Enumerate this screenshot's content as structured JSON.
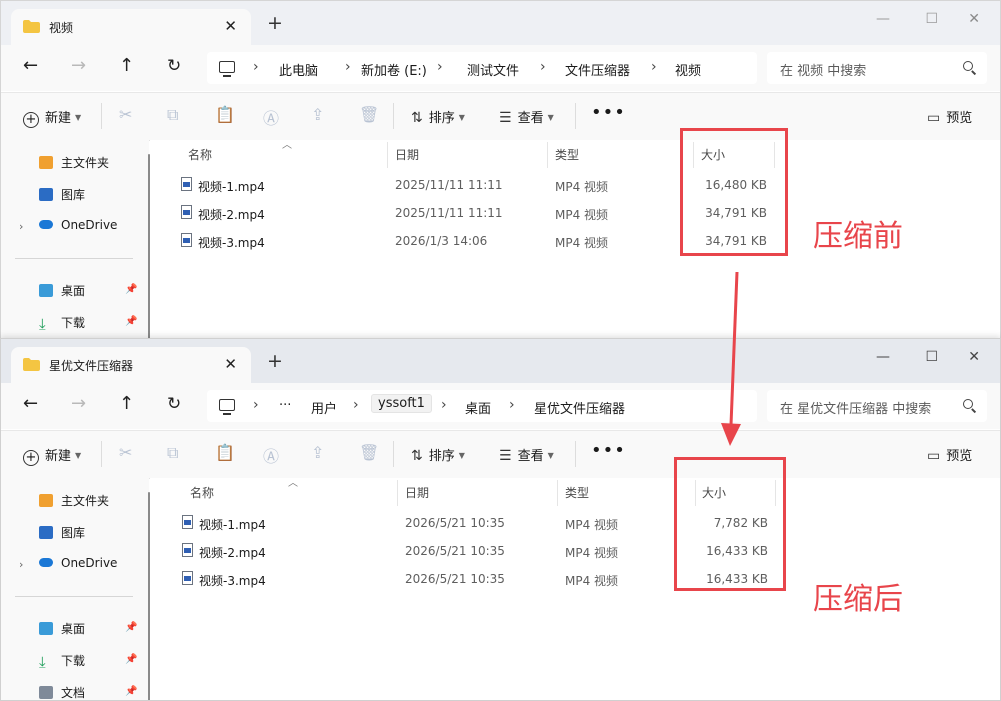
{
  "top_window": {
    "tab_title": "视频",
    "breadcrumbs": [
      "此电脑",
      "新加卷 (E:)",
      "测试文件",
      "文件压缩器",
      "视频"
    ],
    "search_placeholder": "在 视频 中搜索",
    "toolbar": {
      "new_label": "新建",
      "sort_label": "排序",
      "view_label": "查看",
      "more_label": "•••",
      "preview_label": "预览"
    },
    "sidebar": {
      "home": "主文件夹",
      "gallery": "图库",
      "onedrive": "OneDrive",
      "desktop": "桌面",
      "downloads": "下载"
    },
    "columns": {
      "name": "名称",
      "date": "日期",
      "type": "类型",
      "size": "大小"
    },
    "files": [
      {
        "name": "视频-1.mp4",
        "date": "2025/11/11 11:11",
        "type": "MP4 视频",
        "size": "16,480 KB"
      },
      {
        "name": "视频-2.mp4",
        "date": "2025/11/11 11:11",
        "type": "MP4 视频",
        "size": "34,791 KB"
      },
      {
        "name": "视频-3.mp4",
        "date": "2026/1/3 14:06",
        "type": "MP4 视频",
        "size": "34,791 KB"
      }
    ]
  },
  "bottom_window": {
    "tab_title": "星优文件压缩器",
    "breadcrumbs": [
      "···",
      "用户",
      "yssoft1",
      "桌面",
      "星优文件压缩器"
    ],
    "search_placeholder": "在 星优文件压缩器 中搜索",
    "toolbar": {
      "new_label": "新建",
      "sort_label": "排序",
      "view_label": "查看",
      "more_label": "•••",
      "preview_label": "预览"
    },
    "sidebar": {
      "home": "主文件夹",
      "gallery": "图库",
      "onedrive": "OneDrive",
      "desktop": "桌面",
      "downloads": "下载",
      "documents": "文档"
    },
    "columns": {
      "name": "名称",
      "date": "日期",
      "type": "类型",
      "size": "大小"
    },
    "files": [
      {
        "name": "视频-1.mp4",
        "date": "2026/5/21 10:35",
        "type": "MP4 视频",
        "size": "7,782 KB"
      },
      {
        "name": "视频-2.mp4",
        "date": "2026/5/21 10:35",
        "type": "MP4 视频",
        "size": "16,433 KB"
      },
      {
        "name": "视频-3.mp4",
        "date": "2026/5/21 10:35",
        "type": "MP4 视频",
        "size": "16,433 KB"
      }
    ]
  },
  "annotations": {
    "before": "压缩前",
    "after": "压缩后"
  },
  "colors": {
    "highlight": "#e8454b",
    "folder": "#f4c542"
  }
}
